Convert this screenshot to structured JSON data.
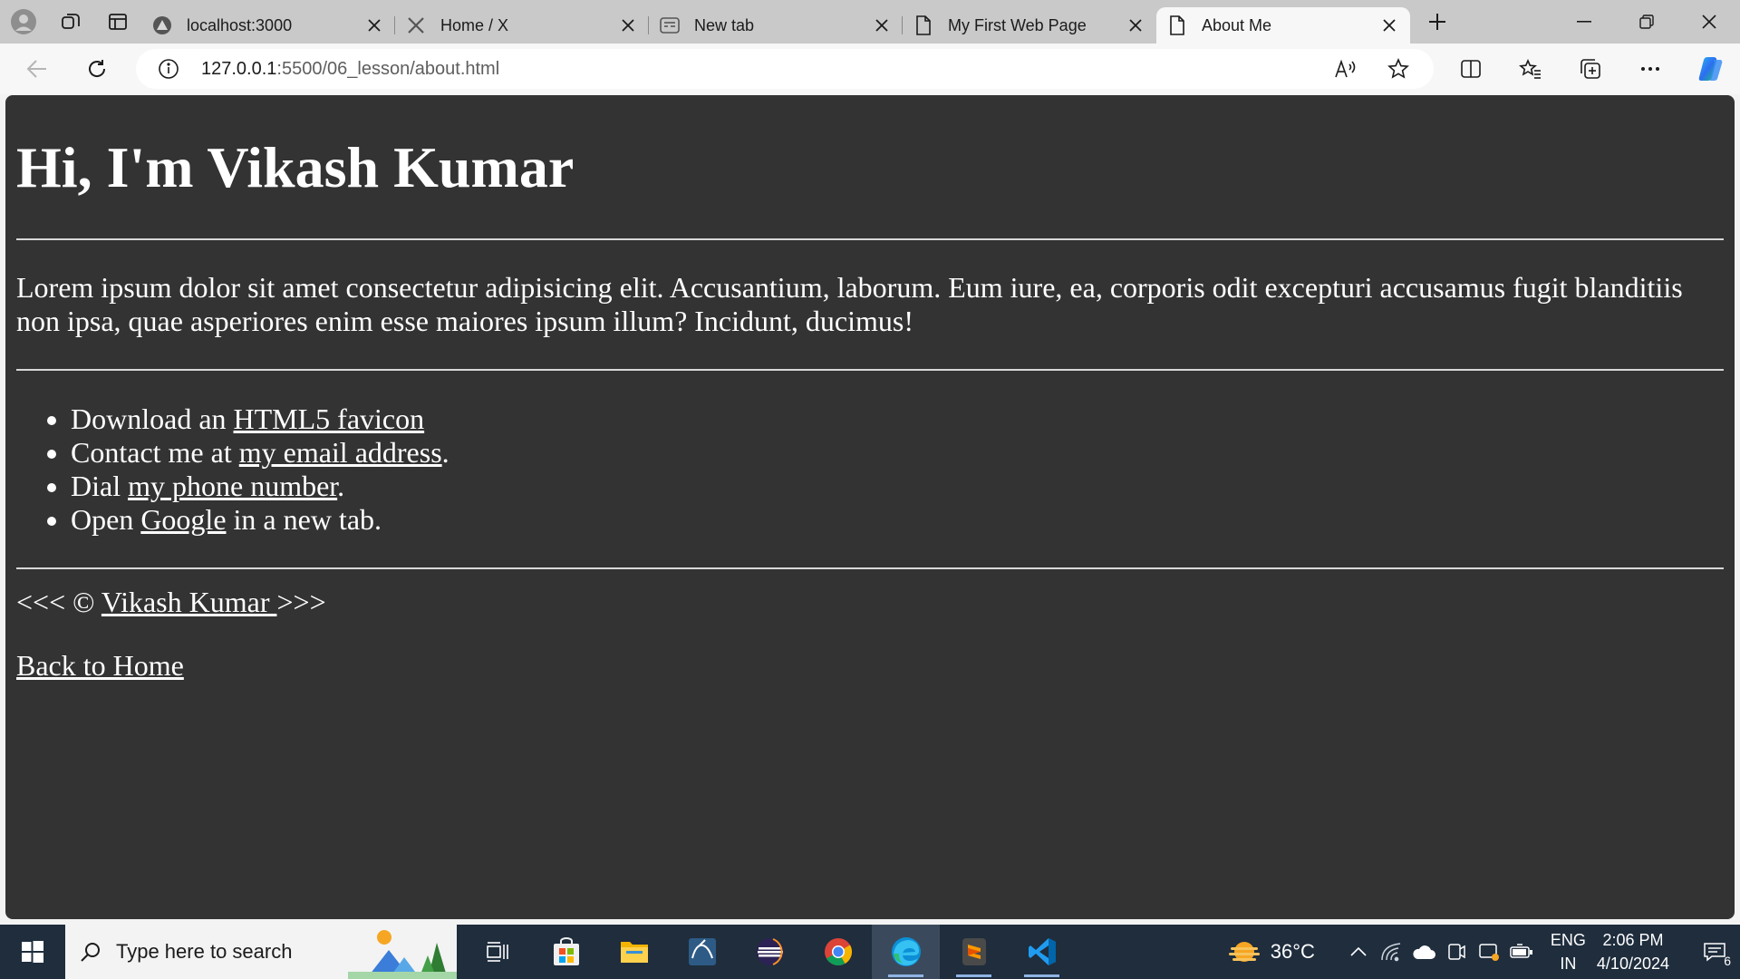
{
  "browser": {
    "tabs": [
      {
        "title": "localhost:3000",
        "icon": "triangle-site-icon"
      },
      {
        "title": "Home / X",
        "icon": "x-logo-icon"
      },
      {
        "title": "New tab",
        "icon": "new-tab-page-icon"
      },
      {
        "title": "My First Web Page",
        "icon": "document-icon"
      },
      {
        "title": "About Me",
        "icon": "document-icon",
        "active": true
      }
    ],
    "address": {
      "host": "127.0.0.1",
      "path": ":5500/06_lesson/about.html"
    }
  },
  "page": {
    "heading": "Hi, I'm Vikash Kumar",
    "paragraph": "Lorem ipsum dolor sit amet consectetur adipisicing elit. Accusantium, laborum. Eum iure, ea, corporis odit excepturi accusamus fugit blanditiis non ipsa, quae asperiores enim esse maiores ipsum illum? Incidunt, ducimus!",
    "links": [
      {
        "prefix": "Download an ",
        "link": "HTML5 favicon",
        "suffix": ""
      },
      {
        "prefix": "Contact me at ",
        "link": "my email address",
        "suffix": "."
      },
      {
        "prefix": "Dial ",
        "link": "my phone number",
        "suffix": "."
      },
      {
        "prefix": "Open ",
        "link": "Google",
        "suffix": " in a new tab."
      }
    ],
    "footer": {
      "prefix": "<<< © ",
      "link": "Vikash Kumar ",
      "suffix": ">>>"
    },
    "back_link": "Back to Home",
    "background": "#333333",
    "text_color": "#ffffff"
  },
  "taskbar": {
    "search_placeholder": "Type here to search",
    "weather": "36°C",
    "lang_line1": "ENG",
    "lang_line2": "IN",
    "time": "2:06 PM",
    "date": "4/10/2024",
    "notification_count": "6"
  }
}
